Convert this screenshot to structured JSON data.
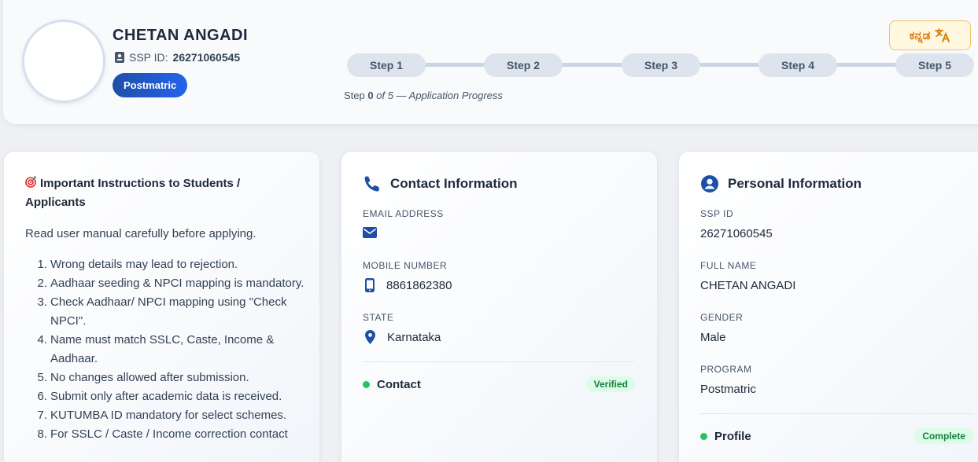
{
  "header": {
    "name": "CHETAN ANGADI",
    "ssp_label": "SSP ID:",
    "ssp_id": "26271060545",
    "program_badge": "Postmatric",
    "language_button": "ಕನ್ನಡ",
    "language_icon": "translate-icon"
  },
  "steps": {
    "items": [
      "Step 1",
      "Step 2",
      "Step 3",
      "Step 4",
      "Step 5"
    ],
    "progress_prefix": "Step",
    "current": "0",
    "progress_suffix": "of 5 — Application Progress"
  },
  "instructions": {
    "title": "Important Instructions to Students / Applicants",
    "intro": "Read user manual carefully before applying.",
    "items": [
      {
        "num": "1.",
        "text": "Wrong details may lead to rejection."
      },
      {
        "num": "2.",
        "text": "Aadhaar seeding & NPCI mapping is mandatory."
      },
      {
        "num": "3.",
        "text": "Check Aadhaar/ NPCI mapping using \"Check NPCI\"."
      },
      {
        "num": "4.",
        "text": "Name must match SSLC, Caste, Income & Aadhaar."
      },
      {
        "num": "5.",
        "text": "No changes allowed after submission."
      },
      {
        "num": "6.",
        "text": "Submit only after academic data is received."
      },
      {
        "num": "7.",
        "text": "KUTUMBA ID mandatory for select schemes."
      },
      {
        "num": "8.",
        "text": "For SSLC / Caste / Income correction contact"
      }
    ]
  },
  "contact": {
    "title": "Contact Information",
    "email_label": "EMAIL ADDRESS",
    "email_value": "",
    "mobile_label": "MOBILE NUMBER",
    "mobile_value": "8861862380",
    "state_label": "STATE",
    "state_value": "Karnataka",
    "status_label": "Contact",
    "status_badge": "Verified"
  },
  "personal": {
    "title": "Personal Information",
    "ssp_label": "SSP ID",
    "ssp_value": "26271060545",
    "name_label": "FULL NAME",
    "name_value": "CHETAN ANGADI",
    "gender_label": "GENDER",
    "gender_value": "Male",
    "program_label": "PROGRAM",
    "program_value": "Postmatric",
    "status_label": "Profile",
    "status_badge": "Complete"
  },
  "colors": {
    "accent": "#1e4fa8",
    "icon_blue": "#1e4fa8",
    "success": "#22c55e",
    "lang_orange": "#d97706"
  }
}
